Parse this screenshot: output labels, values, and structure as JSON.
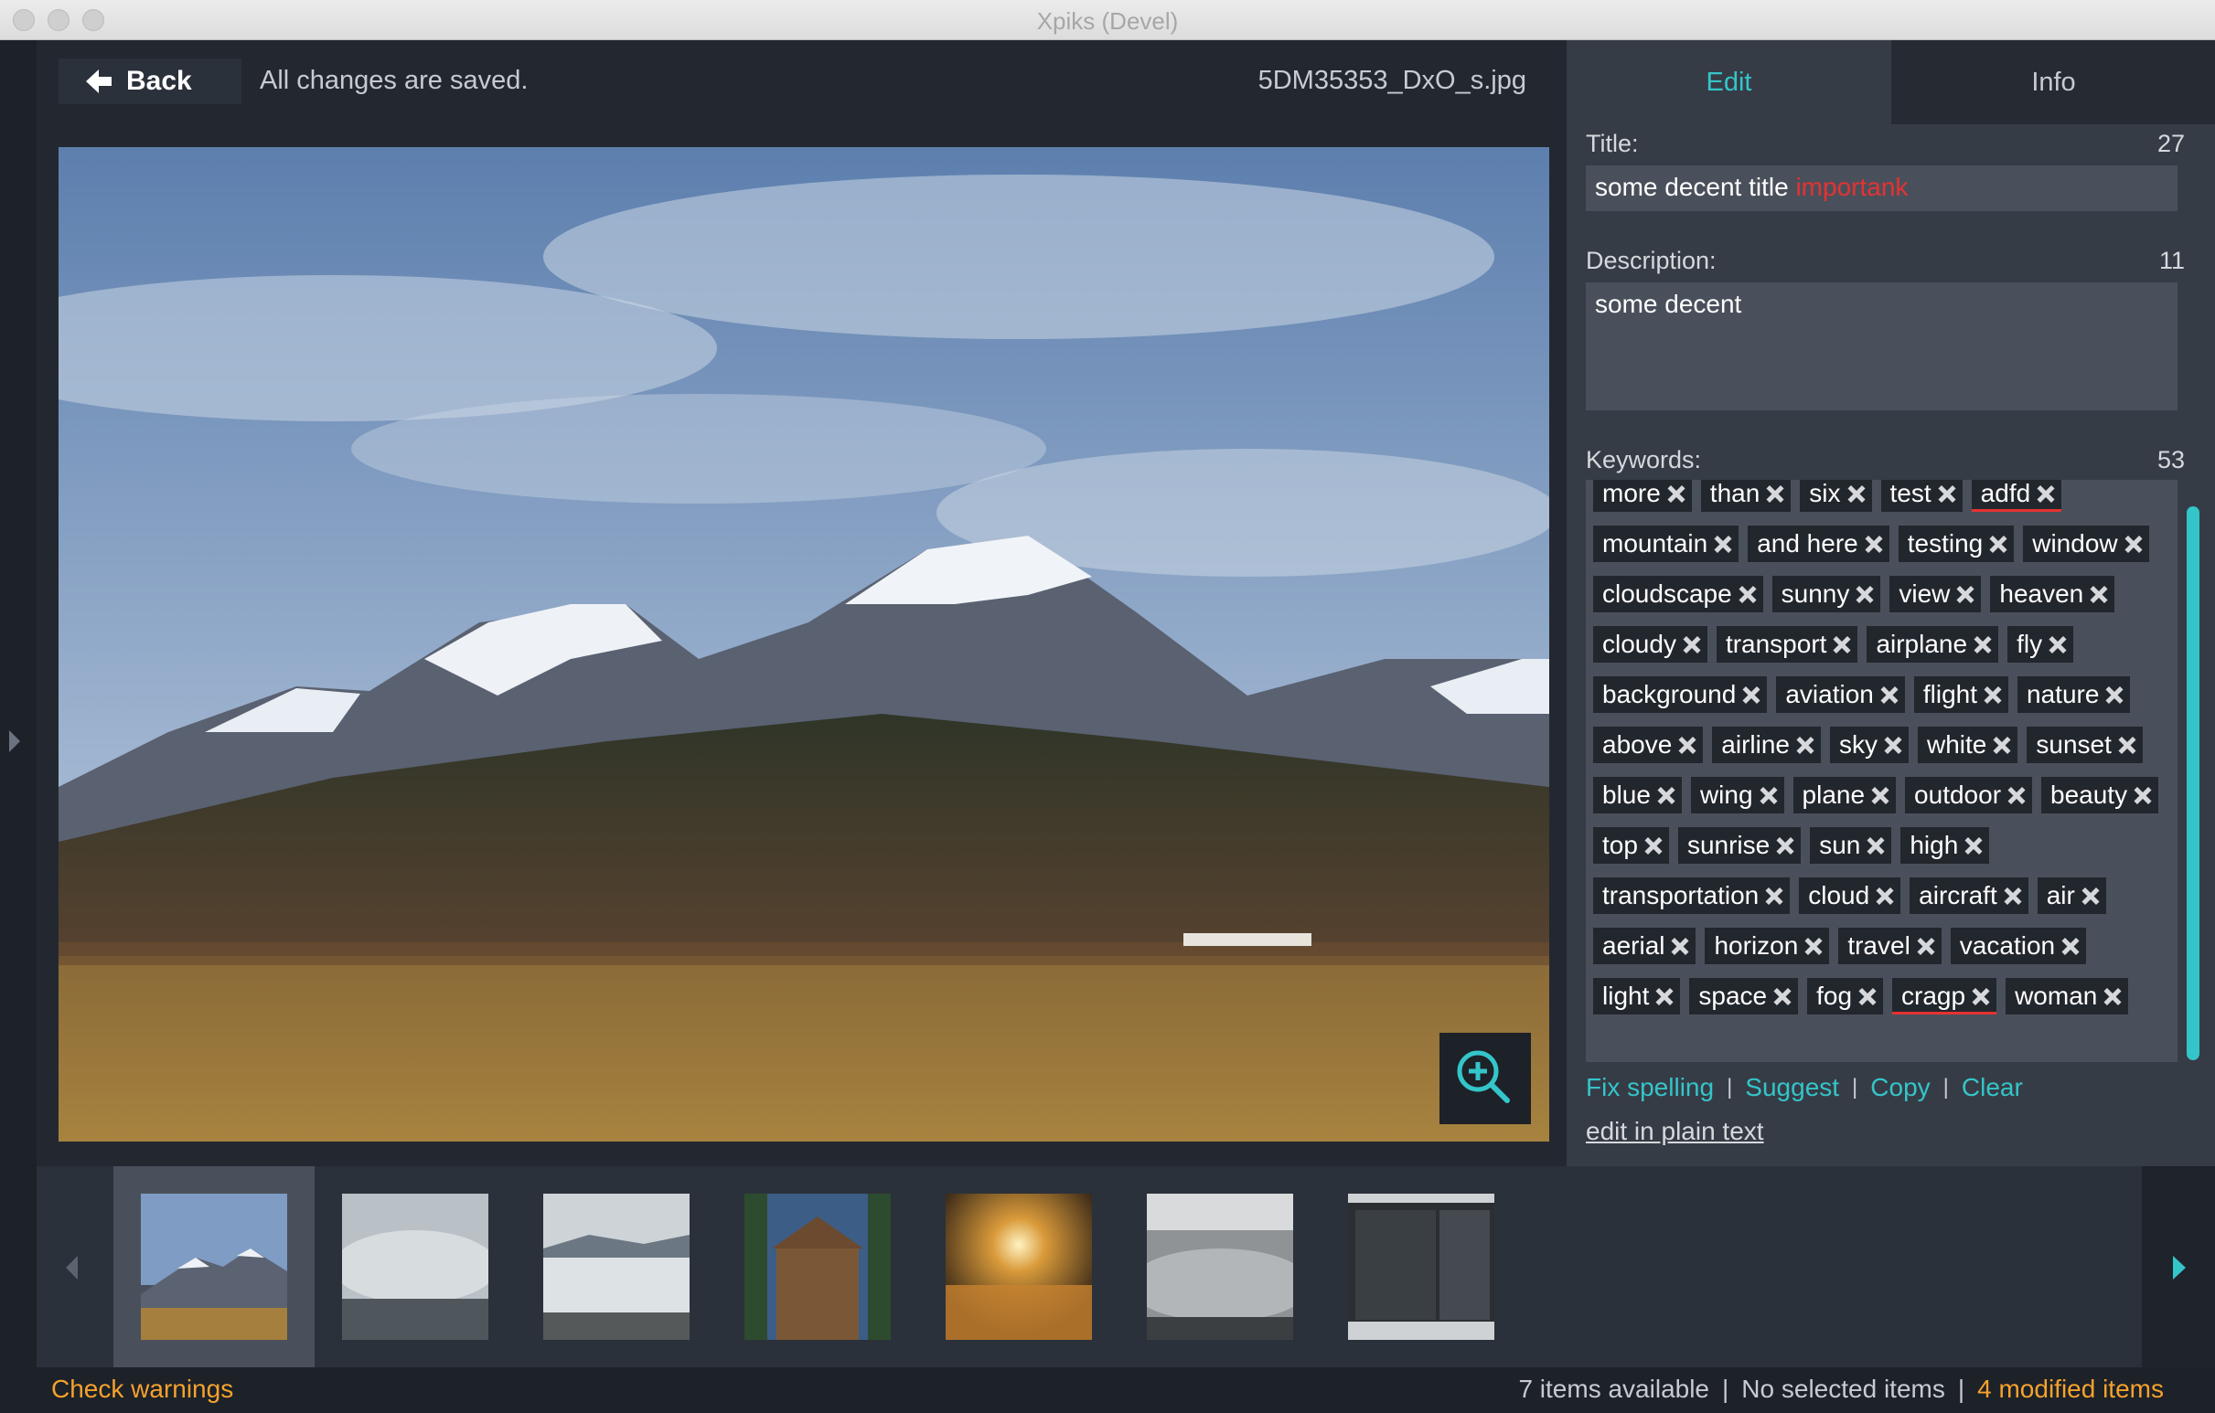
{
  "window": {
    "title": "Xpiks (Devel)"
  },
  "topbar": {
    "back_label": "Back",
    "save_status": "All changes are saved.",
    "filename": "5DM35353_DxO_s.jpg"
  },
  "tabs": [
    {
      "label": "Edit",
      "active": true
    },
    {
      "label": "Info",
      "active": false
    }
  ],
  "fields": {
    "title": {
      "label": "Title:",
      "count": "27",
      "text": "some decent title ",
      "misspelled": "importank"
    },
    "description": {
      "label": "Description:",
      "count": "11",
      "text": "some decent"
    },
    "keywords": {
      "label": "Keywords:",
      "count": "53",
      "items": [
        {
          "text": "more"
        },
        {
          "text": "than"
        },
        {
          "text": "six"
        },
        {
          "text": "test"
        },
        {
          "text": "adfd",
          "misspelled": true
        },
        {
          "text": "mountain"
        },
        {
          "text": "and here"
        },
        {
          "text": "testing"
        },
        {
          "text": "window"
        },
        {
          "text": "cloudscape"
        },
        {
          "text": "sunny"
        },
        {
          "text": "view"
        },
        {
          "text": "heaven"
        },
        {
          "text": "cloudy"
        },
        {
          "text": "transport"
        },
        {
          "text": "airplane"
        },
        {
          "text": "fly"
        },
        {
          "text": "background"
        },
        {
          "text": "aviation"
        },
        {
          "text": "flight"
        },
        {
          "text": "nature"
        },
        {
          "text": "above"
        },
        {
          "text": "airline"
        },
        {
          "text": "sky"
        },
        {
          "text": "white"
        },
        {
          "text": "sunset"
        },
        {
          "text": "blue"
        },
        {
          "text": "wing"
        },
        {
          "text": "plane"
        },
        {
          "text": "outdoor"
        },
        {
          "text": "beauty"
        },
        {
          "text": "top"
        },
        {
          "text": "sunrise"
        },
        {
          "text": "sun"
        },
        {
          "text": "high"
        },
        {
          "text": "transportation"
        },
        {
          "text": "cloud"
        },
        {
          "text": "aircraft"
        },
        {
          "text": "air"
        },
        {
          "text": "aerial"
        },
        {
          "text": "horizon"
        },
        {
          "text": "travel"
        },
        {
          "text": "vacation"
        },
        {
          "text": "light"
        },
        {
          "text": "space"
        },
        {
          "text": "fog"
        },
        {
          "text": "cragp",
          "misspelled": true
        },
        {
          "text": "woman"
        }
      ]
    }
  },
  "actions": {
    "fix_spelling": "Fix spelling",
    "suggest": "Suggest",
    "copy": "Copy",
    "clear": "Clear",
    "plain_text": "edit in plain text"
  },
  "filmstrip": {
    "count_thumbs": 7,
    "selected_index": 0
  },
  "status": {
    "warnings": "Check warnings",
    "available": "7 items available",
    "selected": "No selected items",
    "modified": "4 modified items"
  },
  "colors": {
    "accent": "#34c5c9",
    "warning": "#f5a22d",
    "error": "#e53232"
  }
}
